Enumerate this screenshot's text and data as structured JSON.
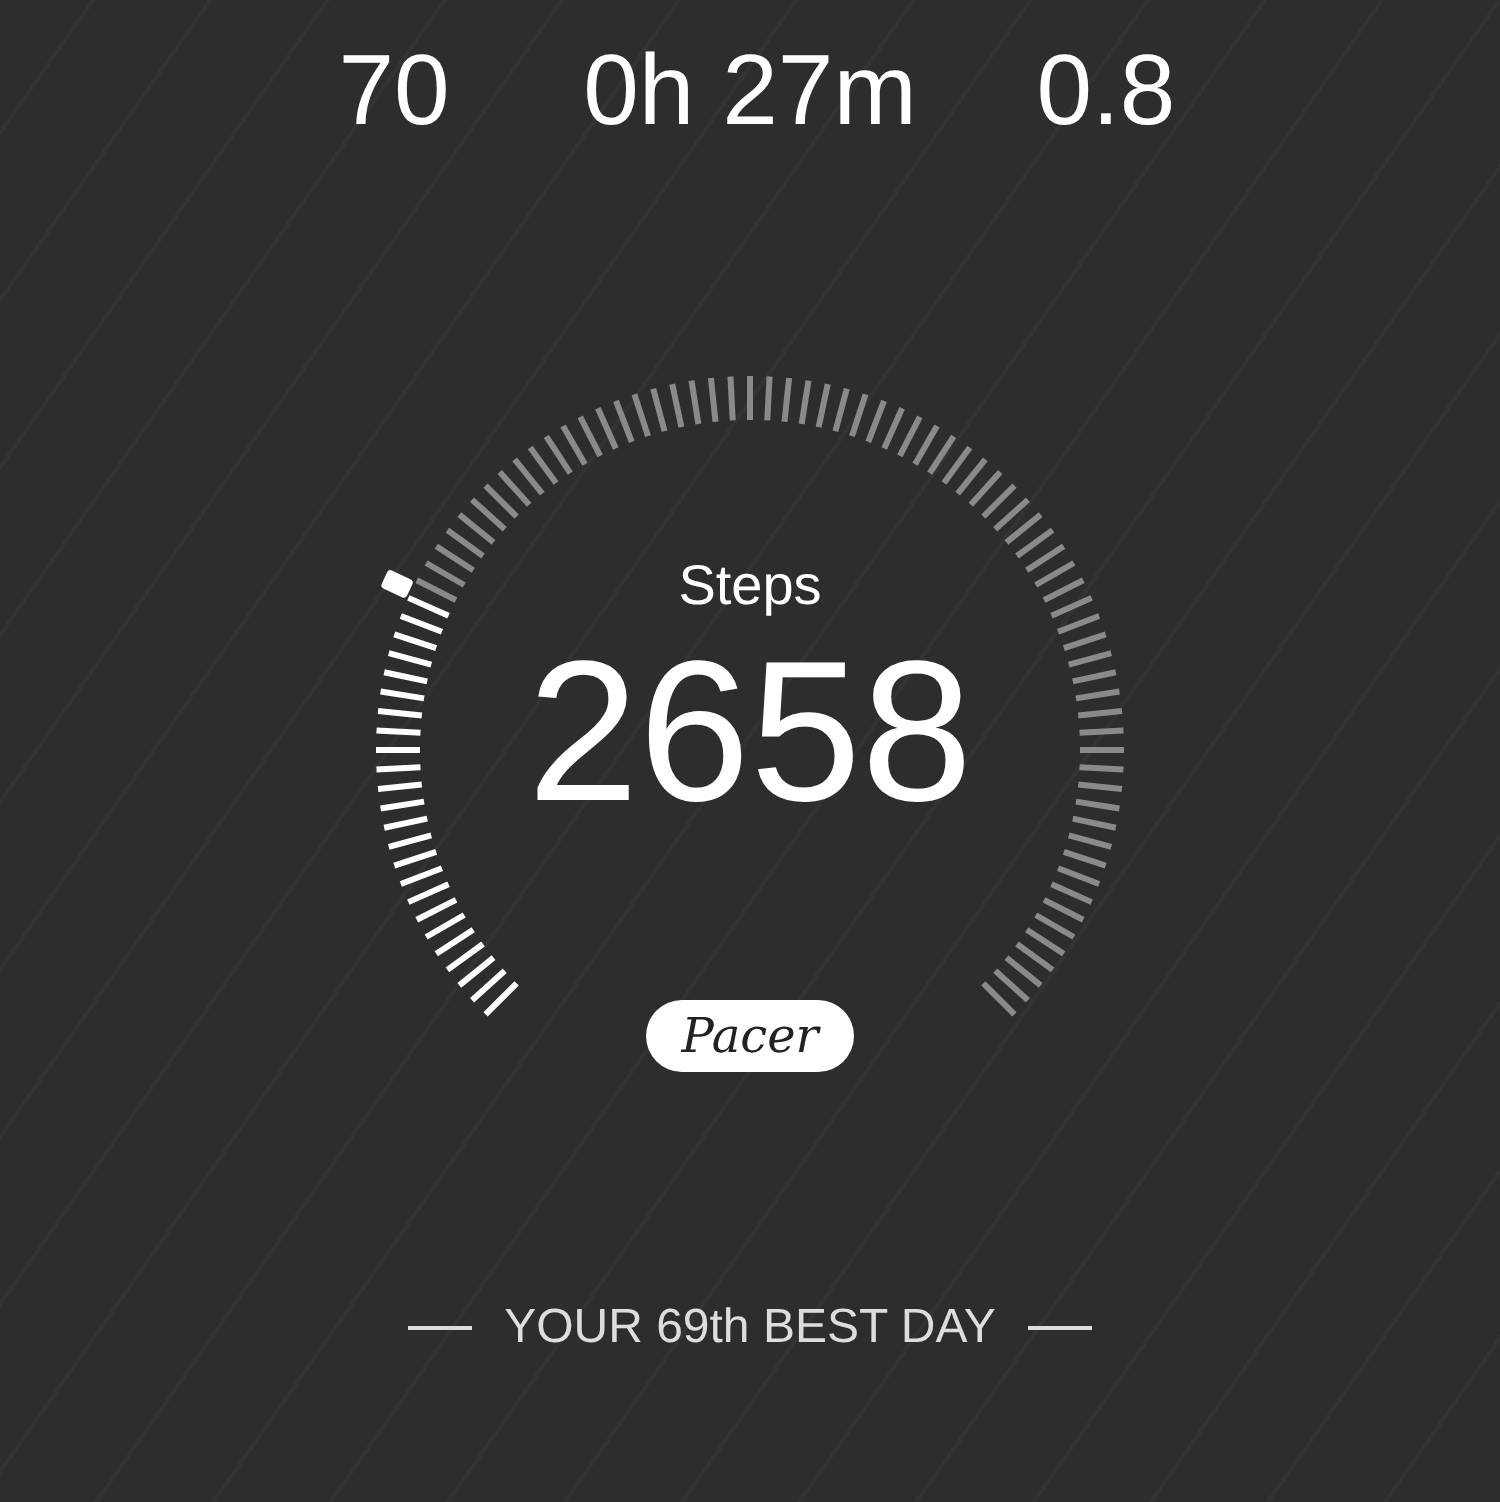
{
  "stats": [
    {
      "value": "70"
    },
    {
      "value": "0h 27m"
    },
    {
      "value": "0.8"
    }
  ],
  "steps": {
    "label": "Steps",
    "value": "2658"
  },
  "badge": "Pacer",
  "rank": "YOUR 69th BEST DAY"
}
